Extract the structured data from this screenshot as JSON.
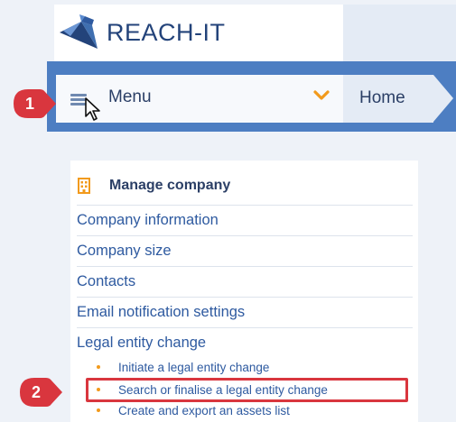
{
  "header": {
    "app_name": "REACH-IT",
    "logo_icon": "reach-it-logo-icon"
  },
  "nav": {
    "menu_label": "Menu",
    "menu_icon": "hamburger-icon",
    "chevron_icon": "chevron-down-icon",
    "breadcrumb_home": "Home"
  },
  "annotations": {
    "step1": "1",
    "step2": "2",
    "badge_color": "#d9363e"
  },
  "panel": {
    "title": "Manage company",
    "icon": "building-icon",
    "items": [
      {
        "label": "Company information"
      },
      {
        "label": "Company size"
      },
      {
        "label": "Contacts"
      },
      {
        "label": "Email notification settings"
      },
      {
        "label": "Legal entity change"
      }
    ],
    "sub_items": [
      {
        "label": "Initiate a legal entity change"
      },
      {
        "label": "Search or finalise a legal entity change"
      },
      {
        "label": "Create and export an assets list"
      }
    ]
  },
  "colors": {
    "accent_orange": "#f29a1c",
    "nav_blue": "#4d7ec2",
    "link_blue": "#2e5aa0",
    "highlight_red": "#d9363e"
  }
}
